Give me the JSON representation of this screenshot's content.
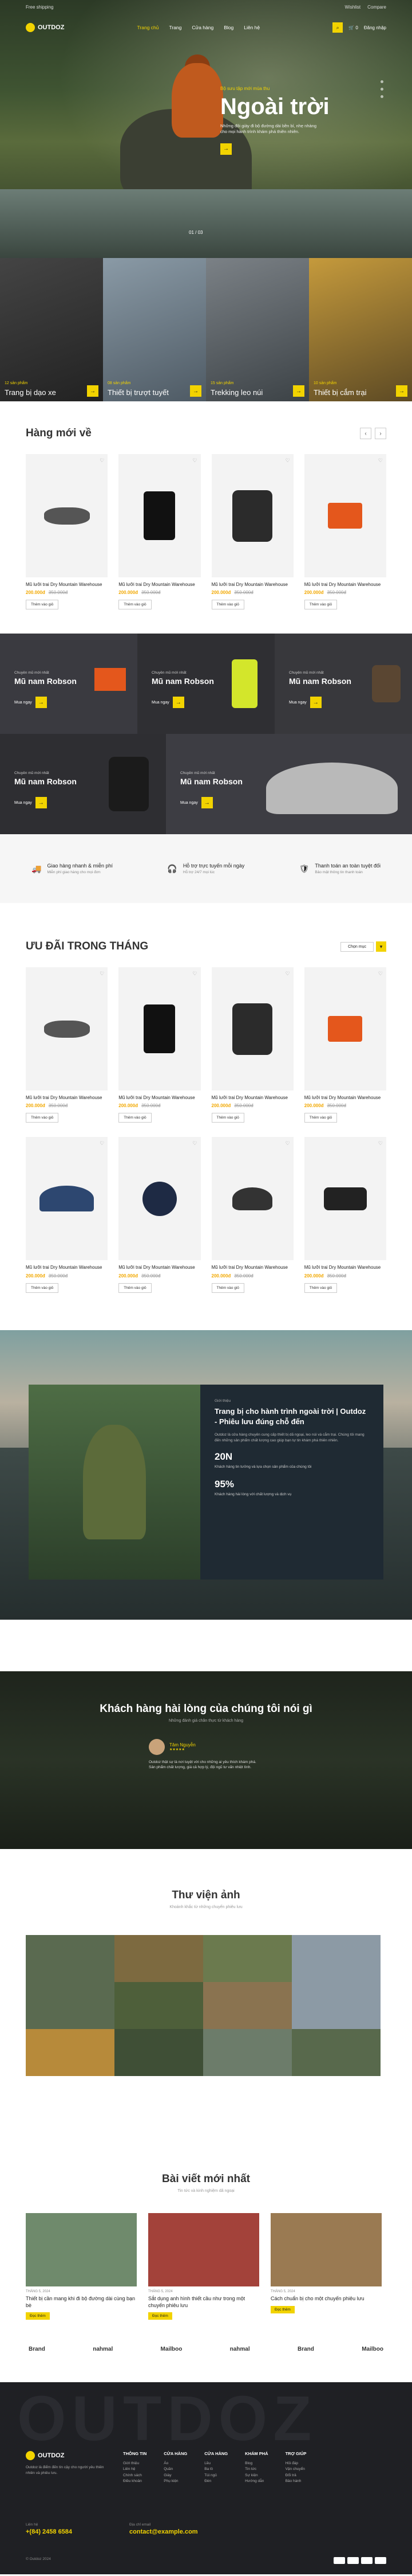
{
  "topbar": {
    "left": "Free shipping",
    "right": [
      "Wishlist",
      "Compare"
    ]
  },
  "nav": {
    "logo": "OUTDOZ",
    "menu": [
      "Trang chủ",
      "Trang",
      "Cửa hàng",
      "Blog",
      "Liên hệ"
    ],
    "cart": "0",
    "account": "Đăng nhập"
  },
  "hero": {
    "subtitle": "Bộ sưu tập mới mùa thu",
    "title": "Ngoài trời",
    "desc": "Những đôi giày đi bộ đường dài bền bỉ, nhẹ nhàng cho mọi hành trình khám phá thiên nhiên.",
    "counter": "01 / 03"
  },
  "categories": [
    {
      "label": "Trang bị dạo xe",
      "count": "12 sản phẩm"
    },
    {
      "label": "Thiết bị trượt tuyết",
      "count": "08 sản phẩm"
    },
    {
      "label": "Trekking leo núi",
      "count": "15 sản phẩm"
    },
    {
      "label": "Thiết bị cắm trại",
      "count": "10 sản phẩm"
    }
  ],
  "new": {
    "title": "Hàng mới về",
    "products": [
      {
        "name": "Mũ lưỡi trai Dry Mountain Warehouse",
        "price": "200.000đ",
        "old": "350.000đ",
        "btn": "Thêm vào giỏ"
      },
      {
        "name": "Mũ lưỡi trai Dry Mountain Warehouse",
        "price": "200.000đ",
        "old": "350.000đ",
        "btn": "Thêm vào giỏ"
      },
      {
        "name": "Mũ lưỡi trai Dry Mountain Warehouse",
        "price": "200.000đ",
        "old": "350.000đ",
        "btn": "Thêm vào giỏ"
      },
      {
        "name": "Mũ lưỡi trai Dry Mountain Warehouse",
        "price": "200.000đ",
        "old": "350.000đ",
        "btn": "Thêm vào giỏ"
      }
    ]
  },
  "promo": [
    {
      "tag": "Chuyên mũ mới nhất",
      "name": "Mũ nam Robson",
      "buy": "Mua ngay"
    },
    {
      "tag": "Chuyên mũ mới nhất",
      "name": "Mũ nam Robson",
      "buy": "Mua ngay"
    },
    {
      "tag": "Chuyên mũ mới nhất",
      "name": "Mũ nam Robson",
      "buy": "Mua ngay"
    },
    {
      "tag": "Chuyên mũ mới nhất",
      "name": "Mũ nam Robson",
      "buy": "Mua ngay"
    },
    {
      "tag": "Chuyên mũ mới nhất",
      "name": "Mũ nam Robson",
      "buy": "Mua ngay"
    }
  ],
  "features": [
    {
      "title": "Giao hàng nhanh & miễn phí",
      "sub": "Miễn phí giao hàng cho mọi đơn"
    },
    {
      "title": "Hỗ trợ trực tuyến mỗi ngày",
      "sub": "Hỗ trợ 24/7 mọi lúc"
    },
    {
      "title": "Thanh toán an toàn tuyệt đối",
      "sub": "Bảo mật thông tin thanh toán"
    }
  ],
  "deals": {
    "title": "ƯU ĐÃI TRONG THÁNG",
    "filter": "Chọn mục",
    "products": [
      {
        "name": "Mũ lưỡi trai Dry Mountain Warehouse",
        "price": "200.000đ",
        "old": "350.000đ",
        "btn": "Thêm vào giỏ"
      },
      {
        "name": "Mũ lưỡi trai Dry Mountain Warehouse",
        "price": "200.000đ",
        "old": "350.000đ",
        "btn": "Thêm vào giỏ"
      },
      {
        "name": "Mũ lưỡi trai Dry Mountain Warehouse",
        "price": "200.000đ",
        "old": "350.000đ",
        "btn": "Thêm vào giỏ"
      },
      {
        "name": "Mũ lưỡi trai Dry Mountain Warehouse",
        "price": "200.000đ",
        "old": "350.000đ",
        "btn": "Thêm vào giỏ"
      },
      {
        "name": "Mũ lưỡi trai Dry Mountain Warehouse",
        "price": "200.000đ",
        "old": "350.000đ",
        "btn": "Thêm vào giỏ"
      },
      {
        "name": "Mũ lưỡi trai Dry Mountain Warehouse",
        "price": "200.000đ",
        "old": "350.000đ",
        "btn": "Thêm vào giỏ"
      },
      {
        "name": "Mũ lưỡi trai Dry Mountain Warehouse",
        "price": "200.000đ",
        "old": "350.000đ",
        "btn": "Thêm vào giỏ"
      },
      {
        "name": "Mũ lưỡi trai Dry Mountain Warehouse",
        "price": "200.000đ",
        "old": "350.000đ",
        "btn": "Thêm vào giỏ"
      }
    ]
  },
  "about": {
    "small": "Giới thiệu",
    "title": "Trang bị cho hành trình ngoài trời | Outdoz - Phiêu lưu đúng chỗ đến",
    "desc": "Outdoz là cửa hàng chuyên cung cấp thiết bị dã ngoại, leo núi và cắm trại. Chúng tôi mang đến những sản phẩm chất lượng cao giúp bạn tự tin khám phá thiên nhiên.",
    "stat1": "20N",
    "stat1_label": "Khách hàng tin tưởng và lựa chọn sản phẩm của chúng tôi",
    "stat2": "95%",
    "stat2_label": "Khách hàng hài lòng với chất lượng và dịch vụ"
  },
  "testimonials": {
    "title": "Khách hàng hài lòng của chúng tôi nói gì",
    "sub": "Những đánh giá chân thực từ khách hàng",
    "name": "Tâm Nguyễn",
    "stars": "★★★★★",
    "text": "Outdoz thật sự là nơi tuyệt vời cho những ai yêu thích khám phá. Sản phẩm chất lượng, giá cả hợp lý, đội ngũ tư vấn nhiệt tình."
  },
  "gallery": {
    "title": "Thư viện ảnh",
    "sub": "Khoảnh khắc từ những chuyến phiêu lưu"
  },
  "blog": {
    "title": "Bài viết mới nhất",
    "sub": "Tin tức và kinh nghiệm dã ngoại",
    "posts": [
      {
        "date": "THÁNG 5, 2024",
        "title": "Thiết bị cần mang khi đi bộ đường dài cùng bạn bè",
        "more": "Đọc thêm"
      },
      {
        "date": "THÁNG 5, 2024",
        "title": "Sắt dụng anh hình thiết cầu như trong một chuyến phiêu lưu",
        "more": "Đọc thêm"
      },
      {
        "date": "THÁNG 5, 2024",
        "title": "Cách chuẩn bị cho một chuyến phiêu lưu",
        "more": "Đọc thêm"
      }
    ]
  },
  "brands": [
    "Brand",
    "nahmal",
    "Mailboo",
    "nahmal",
    "Brand",
    "Mailboo"
  ],
  "footer": {
    "big": "OUTDOZ",
    "about": "Outdoz là điểm đến tin cậy cho người yêu thiên nhiên và phiêu lưu.",
    "cols": [
      {
        "h": "THÔNG TIN",
        "items": [
          "Giới thiệu",
          "Liên hệ",
          "Chính sách",
          "Điều khoản"
        ]
      },
      {
        "h": "CỬA HÀNG",
        "items": [
          "Áo",
          "Quần",
          "Giày",
          "Phụ kiện"
        ]
      },
      {
        "h": "CỬA HÀNG",
        "items": [
          "Lều",
          "Ba lô",
          "Túi ngủ",
          "Đèn"
        ]
      },
      {
        "h": "KHÁM PHÁ",
        "items": [
          "Blog",
          "Tin tức",
          "Sự kiện",
          "Hướng dẫn"
        ]
      },
      {
        "h": "TRỢ GIÚP",
        "items": [
          "Hỏi đáp",
          "Vận chuyển",
          "Đổi trả",
          "Bảo hành"
        ]
      }
    ],
    "phone_label": "Liên hệ",
    "phone": "+(84) 2458 6584",
    "mail_label": "Địa chỉ email",
    "mail": "contact@example.com",
    "copy": "© Outdoz 2024"
  }
}
